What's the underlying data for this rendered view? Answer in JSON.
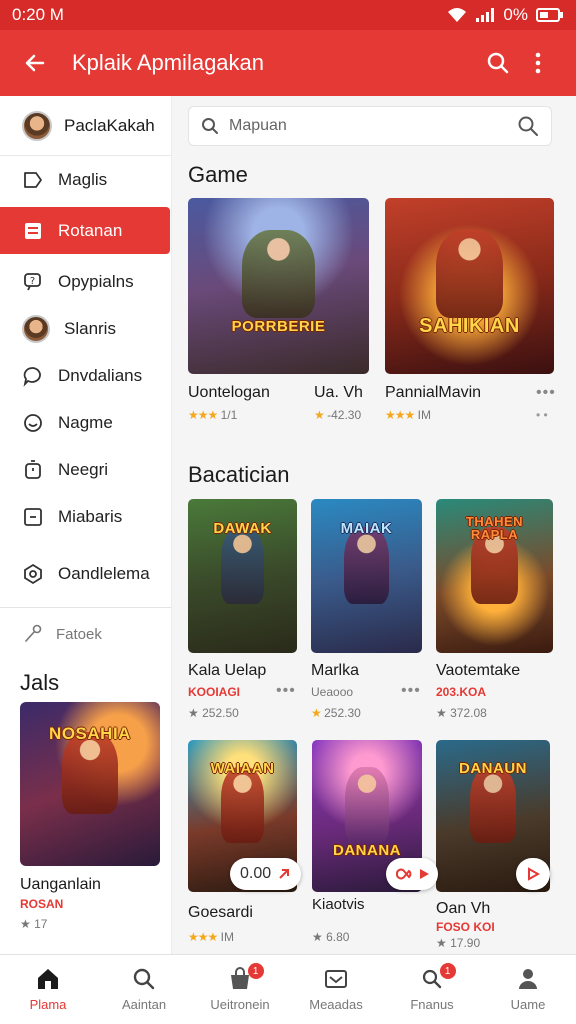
{
  "status": {
    "time": "0:20 M",
    "battery": "0%"
  },
  "appbar": {
    "title": "Kplaik Apmilagakan"
  },
  "sidebar": {
    "profile_name": "PaclaKakah",
    "items": [
      {
        "label": "Maglis",
        "icon": "tag-icon"
      },
      {
        "label": "Rotanan",
        "icon": "inbox-icon",
        "active": true
      },
      {
        "label": "Opypialns",
        "icon": "help-icon"
      },
      {
        "label": "Slanris",
        "icon": "avatar"
      },
      {
        "label": "Dnvdalians",
        "icon": "chat-icon"
      },
      {
        "label": "Nagme",
        "icon": "smile-icon"
      },
      {
        "label": "Neegri",
        "icon": "timer-icon"
      },
      {
        "label": "Miabaris",
        "icon": "minus-box-icon"
      },
      {
        "label": "Oandlelema",
        "icon": "settings-icon"
      }
    ],
    "feature_label": "Fatoek",
    "section_title": "Jals",
    "featured": {
      "art_text": "NOSAHIA",
      "name": "Uanganlain",
      "price": "ROSAN",
      "rating": "17"
    }
  },
  "search": {
    "placeholder": "Mapuan"
  },
  "sections": [
    {
      "title": "Game",
      "cards": [
        {
          "art_text": "PORRBERIE",
          "name": "Uontelogan",
          "rating": "1/1",
          "stars": "★★★"
        },
        {
          "art_text": "SAHIKIAN",
          "name": "PannialMavin",
          "rating": "IM",
          "stars": "★★★"
        }
      ],
      "extra": {
        "name": "Ua. Vh",
        "rating": "-42.30"
      }
    },
    {
      "title": "Bacatician",
      "cards": [
        {
          "art_text": "DAWAK",
          "name": "Kala Uelap",
          "price": "KOOIAGI",
          "rating": "252.50"
        },
        {
          "art_text": "MAIAK",
          "name": "Marlka",
          "price": "Ueaooo",
          "rating": "252.30"
        },
        {
          "art_text": "THAHEN RAPLA",
          "name": "Vaotemtake",
          "price": "203.KOA",
          "rating": "372.08"
        }
      ]
    },
    {
      "cards": [
        {
          "art_text": "WAIAAN",
          "name": "Goesardi",
          "rating": "IM",
          "pill": "0.00"
        },
        {
          "art_text": "DANANA",
          "name": "Kiaotvis",
          "rating": "6.80"
        },
        {
          "art_text": "DANAUN",
          "name": "Oan Vh",
          "price": "FOSO KOI",
          "rating": "17.90"
        }
      ]
    }
  ],
  "bottom_nav": [
    {
      "label": "Plama",
      "icon": "home-icon",
      "active": true
    },
    {
      "label": "Aaintan",
      "icon": "search-icon"
    },
    {
      "label": "Ueitronein",
      "icon": "store-icon",
      "badge": "1"
    },
    {
      "label": "Meaadas",
      "icon": "mail-icon"
    },
    {
      "label": "Fnanus",
      "icon": "user-search-icon",
      "badge": "1"
    },
    {
      "label": "Uame",
      "icon": "profile-icon"
    }
  ],
  "colors": {
    "accent": "#e53935",
    "status_bar": "#d62b28"
  }
}
